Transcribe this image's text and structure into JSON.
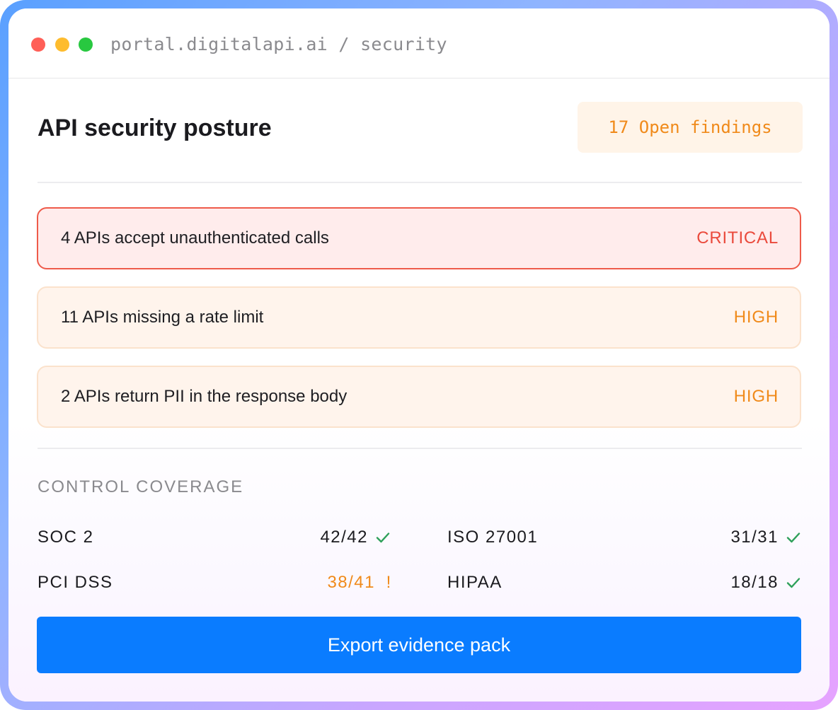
{
  "window": {
    "url": "portal.digitalapi.ai / security"
  },
  "header": {
    "title": "API security posture",
    "badge": "17 Open findings"
  },
  "findings": [
    {
      "text": "4 APIs accept unauthenticated calls",
      "severity": "CRITICAL"
    },
    {
      "text": "11 APIs missing a rate limit",
      "severity": "HIGH"
    },
    {
      "text": "2 APIs return PII in the response body",
      "severity": "HIGH"
    }
  ],
  "coverage": {
    "label": "CONTROL COVERAGE",
    "items": [
      {
        "name": "SOC 2",
        "value": "42/42",
        "status": "check-icon"
      },
      {
        "name": "ISO 27001",
        "value": "31/31",
        "status": "check-icon"
      },
      {
        "name": "PCI DSS",
        "value": "38/41",
        "status": "warning-icon",
        "status_text": "!"
      },
      {
        "name": "HIPAA",
        "value": "18/18",
        "status": "check-icon"
      }
    ]
  },
  "actions": {
    "export_label": "Export evidence pack"
  },
  "colors": {
    "accent": "#0a7cff",
    "critical": "#ea4a3c",
    "high": "#f08a1a",
    "ok": "#2ea05a"
  }
}
